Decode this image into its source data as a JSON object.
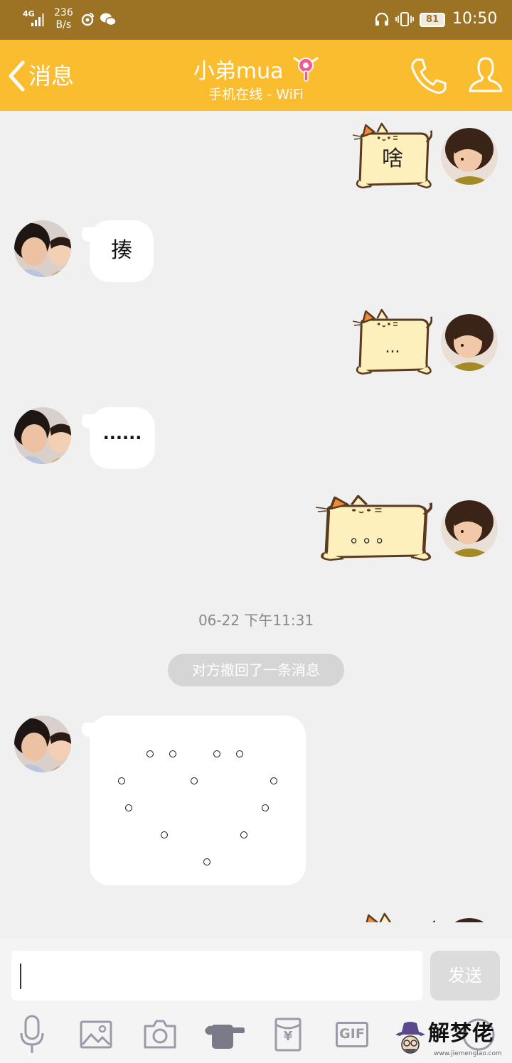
{
  "status_bar": {
    "network": "4G",
    "speed_value": "236",
    "speed_unit": "B/s",
    "battery": "81",
    "time": "10:50"
  },
  "header": {
    "back_label": "消息",
    "contact_name": "小弟mua",
    "contact_status": "手机在线 - WiFi"
  },
  "messages": [
    {
      "side": "out",
      "kind": "sticker",
      "text": "啥"
    },
    {
      "side": "in",
      "kind": "text",
      "text": "揍"
    },
    {
      "side": "out",
      "kind": "sticker",
      "text": "..."
    },
    {
      "side": "in",
      "kind": "text",
      "text": "......"
    },
    {
      "side": "out",
      "kind": "sticker",
      "text": "。。。"
    },
    {
      "side": "in",
      "kind": "heart",
      "text": ""
    }
  ],
  "timestamp": "06-22 下午11:31",
  "recall_notice": "对方撤回了一条消息",
  "input": {
    "placeholder": "",
    "send_label": "发送"
  },
  "toolbar": [
    {
      "name": "voice-icon"
    },
    {
      "name": "image-icon"
    },
    {
      "name": "camera-icon"
    },
    {
      "name": "poke-icon"
    },
    {
      "name": "red-packet-icon",
      "label": "¥"
    },
    {
      "name": "gif-icon",
      "label": "GIF"
    },
    {
      "name": "more-emoji-icon"
    }
  ],
  "watermark": {
    "text": "解梦佬",
    "url": "www.jiemenglao.com"
  },
  "colors": {
    "status_bar": "#9c7225",
    "title_bar": "#fbbd30",
    "background": "#f0f0f0",
    "bubble": "#ffffff",
    "sticker_fill": "#fdf0bd",
    "sticker_stroke": "#5b3b1f"
  }
}
